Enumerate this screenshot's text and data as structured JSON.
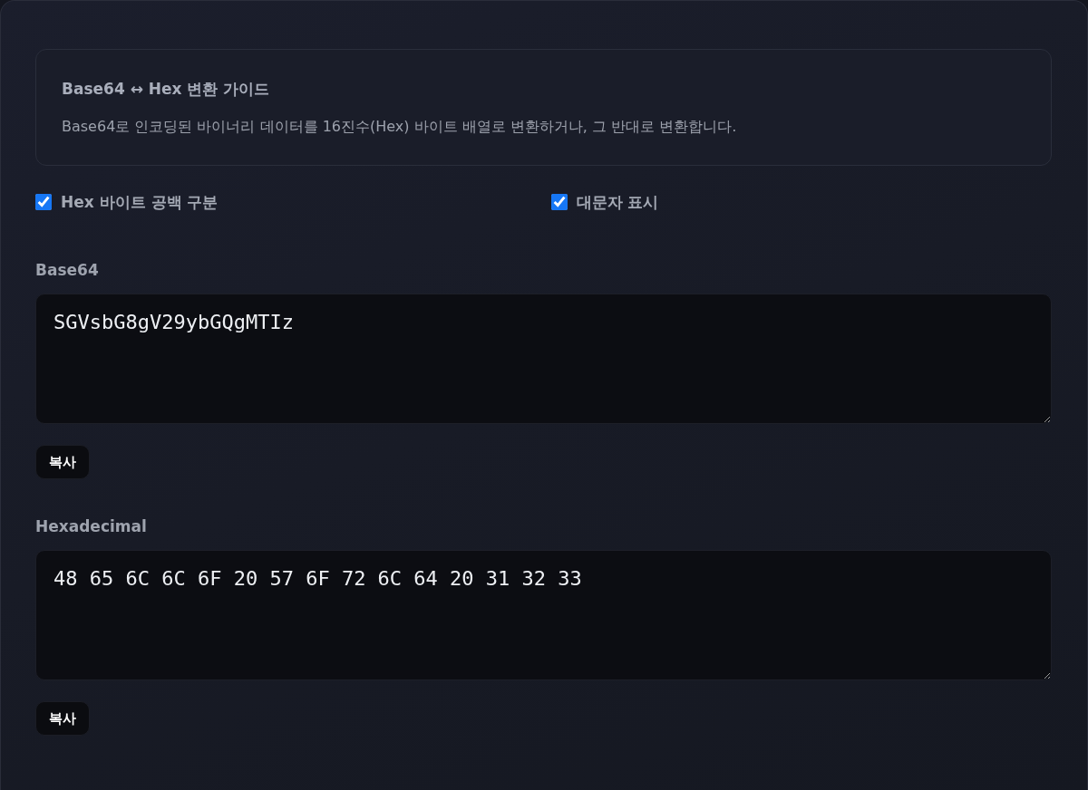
{
  "guide": {
    "title": "Base64 ↔ Hex 변환 가이드",
    "description": "Base64로 인코딩된 바이너리 데이터를 16진수(Hex) 바이트 배열로 변환하거나, 그 반대로 변환합니다."
  },
  "options": [
    {
      "label": "Hex 바이트 공백 구분",
      "checked": true
    },
    {
      "label": "대문자 표시",
      "checked": true
    }
  ],
  "fields": [
    {
      "label": "Base64",
      "value": "SGVsbG8gV29ybGQgMTIz",
      "copy_button": "복사"
    },
    {
      "label": "Hexadecimal",
      "value": "48 65 6C 6C 6F 20 57 6F 72 6C 64 20 31 32 33",
      "copy_button": "복사"
    }
  ]
}
